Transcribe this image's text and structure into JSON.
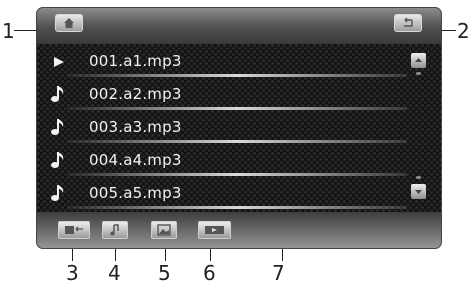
{
  "callouts": [
    "1",
    "2",
    "3",
    "4",
    "5",
    "6",
    "7"
  ],
  "topbar": {
    "home_icon": "home-icon",
    "back_icon": "back-arrow-icon"
  },
  "playlist": {
    "items": [
      {
        "name": "001.a1.mp3",
        "icon": "play-icon",
        "playing": true
      },
      {
        "name": "002.a2.mp3",
        "icon": "music-note-icon",
        "playing": false
      },
      {
        "name": "003.a3.mp3",
        "icon": "music-note-icon",
        "playing": false
      },
      {
        "name": "004.a4.mp3",
        "icon": "music-note-icon",
        "playing": false
      },
      {
        "name": "005.a5.mp3",
        "icon": "music-note-icon",
        "playing": false
      }
    ]
  },
  "scrollbar": {
    "up_icon": "scroll-up-icon",
    "down_icon": "scroll-down-icon"
  },
  "bottombar": {
    "buttons": [
      "return-folder-icon",
      "music-note-icon",
      "photo-icon",
      "video-icon"
    ]
  },
  "colors": {
    "bar_top": "#8c8c8c",
    "list_bg": "#141414",
    "text": "#f2f2f2",
    "button_face": "#e9e9e9"
  }
}
